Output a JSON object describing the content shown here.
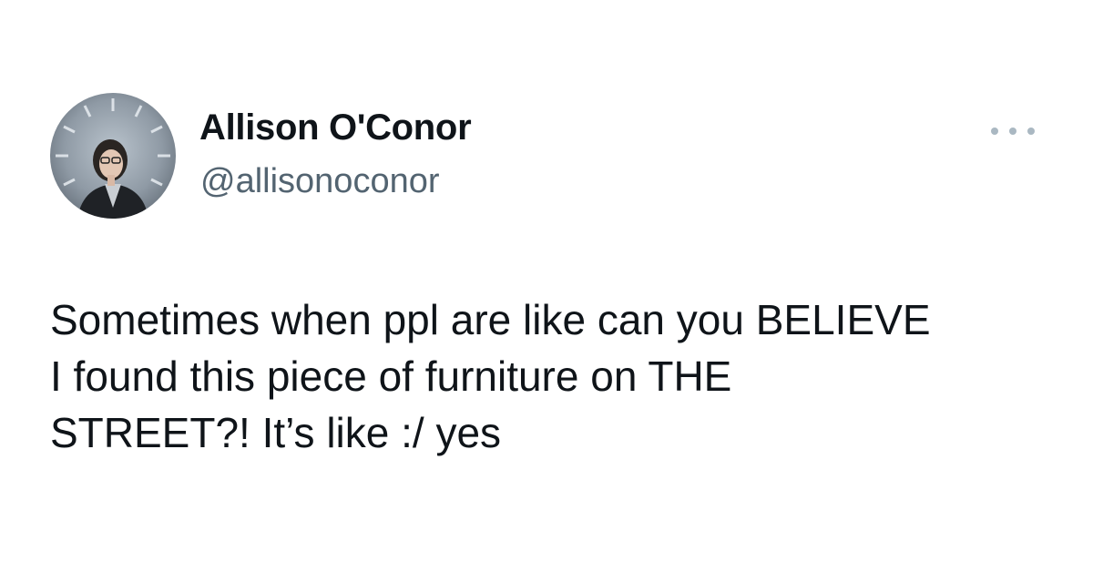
{
  "author": {
    "display_name": "Allison O'Conor",
    "handle": "@allisonoconor",
    "avatar_icon": "profile-photo"
  },
  "actions": {
    "more_icon": "more-horizontal-icon"
  },
  "tweet": {
    "lines": [
      "Sometimes when ppl are like can you BELIEVE",
      "I found this piece of furniture on THE",
      "STREET?! It’s like :/ yes"
    ]
  },
  "colors": {
    "text_primary": "#0f1419",
    "text_secondary": "#536471",
    "more_dots": "#aab8c2",
    "background": "#ffffff"
  }
}
